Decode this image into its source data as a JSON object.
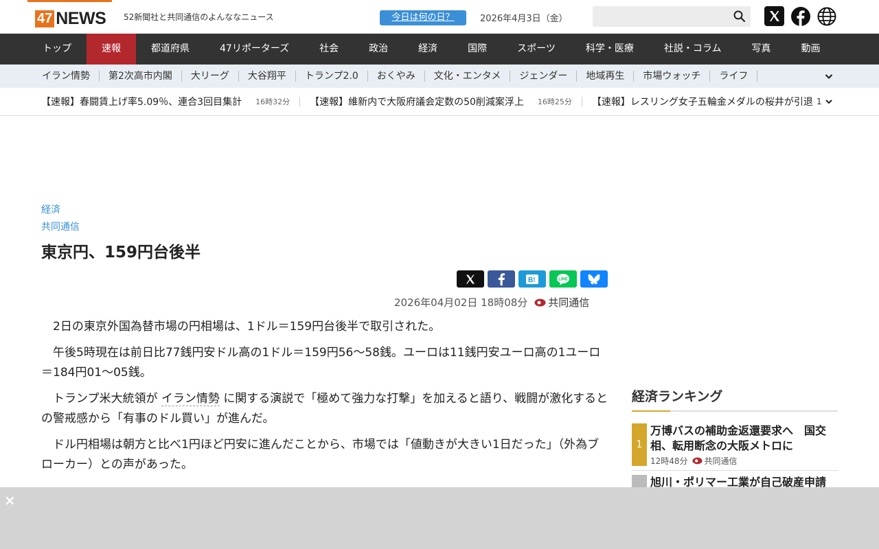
{
  "header": {
    "logo_num": "47",
    "logo_text": "NEWS",
    "tagline": "52新聞社と共同通信のよんななニュース",
    "today_button": "今日は何の日？",
    "date": "2026年4月3日（金）",
    "search_placeholder": ""
  },
  "mainnav": [
    "トップ",
    "速報",
    "都道府県",
    "47リポーターズ",
    "社会",
    "政治",
    "経済",
    "国際",
    "スポーツ",
    "科学・医療",
    "社説・コラム",
    "写真",
    "動画"
  ],
  "subnav": [
    "イラン情勢",
    "第2次高市内閣",
    "大リーグ",
    "大谷翔平",
    "トランプ2.0",
    "おくやみ",
    "文化・エンタメ",
    "ジェンダー",
    "地域再生",
    "市場ウォッチ",
    "ライフ"
  ],
  "ticker": {
    "items": [
      {
        "text": "【速報】春闘賃上げ率5.09％、連合3回目集計",
        "time": "16時32分"
      },
      {
        "text": "【速報】維新内で大阪府議会定数の50削減案浮上",
        "time": "16時25分"
      },
      {
        "text": "【速報】レスリング女子五輪金メダルの桜井が引退",
        "time": ""
      }
    ],
    "count": "1"
  },
  "article": {
    "category": "経済",
    "source": "共同通信",
    "title": "東京円、159円台後半",
    "datetime": "2026年04月02日 18時08分",
    "publisher": "共同通信",
    "paragraphs": {
      "p1": "2日の東京外国為替市場の円相場は、1ドル＝159円台後半で取引された。",
      "p2": "午後5時現在は前日比77銭円安ドル高の1ドル＝159円56～58銭。ユーロは11銭円安ユーロ高の1ユーロ＝184円01～05銭。",
      "p3_pre": "トランプ米大統領が",
      "p3_kw": "イラン情勢",
      "p3_post": "に関する演説で「極めて強力な打撃」を加えると語り、戦闘が激化するとの警戒感から「有事のドル買い」が進んだ。",
      "p4": "ドル円相場は朝方と比べ1円ほど円安に進んだことから、市場では「値動きが大きい1日だった」（外為ブローカー）との声があった。"
    }
  },
  "ranking": {
    "title": "経済ランキング",
    "items": [
      {
        "rank": "1",
        "title": "万博バスの補助金返還要求へ　国交相、転用断念の大阪メトロに",
        "time": "12時48分",
        "publisher": "共同通信"
      },
      {
        "rank": "",
        "title": "旭川・ポリマー工業が自己破産申請",
        "time": "",
        "publisher": ""
      }
    ]
  },
  "ad": {
    "close": "×"
  }
}
